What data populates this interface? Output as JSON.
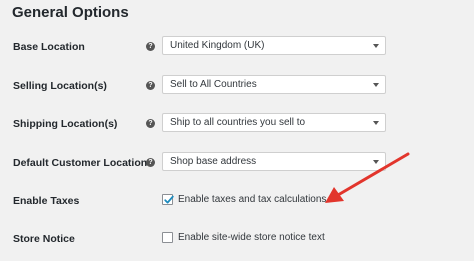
{
  "section": {
    "title": "General Options"
  },
  "rows": [
    {
      "label": "Base Location",
      "value": "United Kingdom (UK)"
    },
    {
      "label": "Selling Location(s)",
      "value": "Sell to All Countries"
    },
    {
      "label": "Shipping Location(s)",
      "value": "Ship to all countries you sell to"
    },
    {
      "label": "Default Customer Location",
      "value": "Shop base address"
    }
  ],
  "enable_taxes": {
    "label": "Enable Taxes",
    "checkbox_label": "Enable taxes and tax calculations",
    "checked": true
  },
  "store_notice": {
    "label": "Store Notice",
    "checkbox_label": "Enable site-wide store notice text",
    "checked": false
  },
  "icons": {
    "help": "help-tip-icon",
    "dropdown": "chevron-down-icon",
    "checkmark": "checkmark-icon",
    "arrow": "arrow-icon"
  },
  "colors": {
    "background": "#f1f1f1",
    "arrow": "#e2352c",
    "checkmark": "#1e8cbe"
  }
}
